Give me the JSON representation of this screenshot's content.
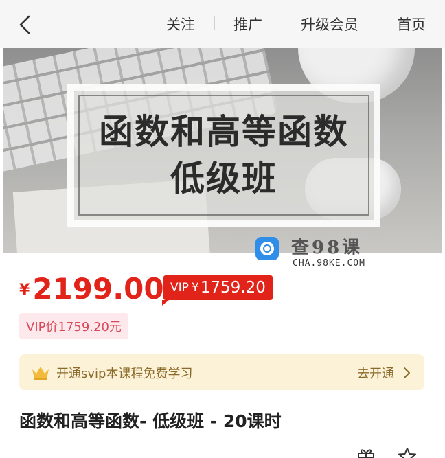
{
  "header": {
    "back_icon": "chevron-left-icon",
    "nav": [
      "关注",
      "推广",
      "升级会员",
      "首页"
    ]
  },
  "banner": {
    "title_line1": "函数和高等函数",
    "title_line2": "低级班"
  },
  "watermark": {
    "title": "查98课",
    "subtitle": "CHA.98KE.COM",
    "logo_color": "#2f8ee8"
  },
  "price": {
    "currency": "¥",
    "amount": "2199.00",
    "color": "#e2231a"
  },
  "vip_badge": {
    "label": "VIP",
    "currency": "¥",
    "amount": "1759.20"
  },
  "vip_price_pill": "VIP价1759.20元",
  "svip_bar": {
    "icon": "crown-icon",
    "text": "开通svip本课程免费学习",
    "action": "去开通"
  },
  "course_title": "函数和高等函数- 低级班 - 20课时",
  "bottom_icons": [
    "gift-icon",
    "star-icon"
  ]
}
